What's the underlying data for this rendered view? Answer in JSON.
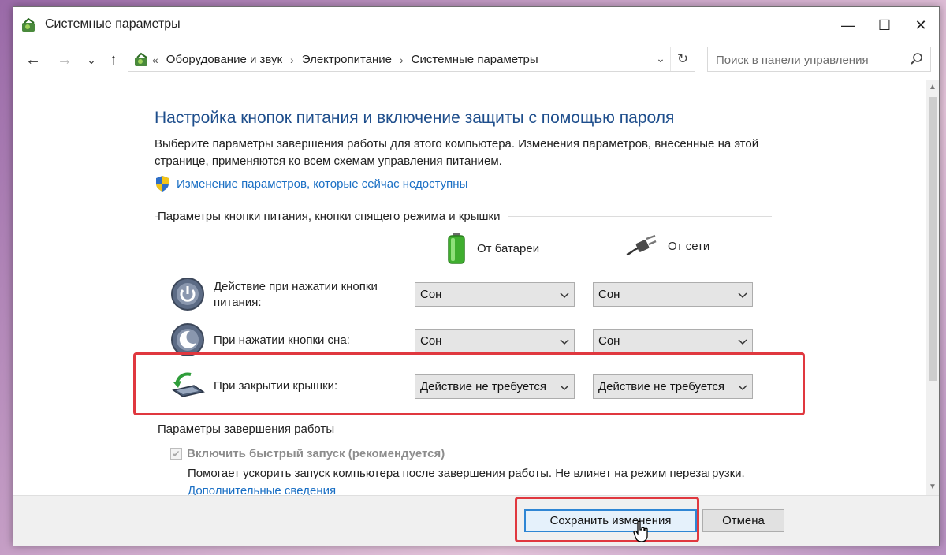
{
  "window": {
    "title": "Системные параметры",
    "controls": {
      "minimize": "—",
      "maximize": "☐",
      "close": "✕"
    }
  },
  "nav": {
    "back": "←",
    "forward": "→",
    "recent": "⌄",
    "up": "↑"
  },
  "address": {
    "overflow": "«",
    "breadcrumbs": [
      "Оборудование и звук",
      "Электропитание",
      "Системные параметры"
    ],
    "separator": "›"
  },
  "search": {
    "placeholder": "Поиск в панели управления"
  },
  "main": {
    "heading": "Настройка кнопок питания и включение защиты с помощью пароля",
    "description": "Выберите параметры завершения работы для этого компьютера. Изменения параметров, внесенные на этой странице, применяются ко всем схемам управления питанием.",
    "uac_link": "Изменение параметров, которые сейчас недоступны",
    "group1_label": "Параметры кнопки питания, кнопки спящего режима и крышки",
    "col_battery": "От батареи",
    "col_ac": "От сети",
    "rows": [
      {
        "label": "Действие при нажатии кнопки питания:",
        "battery": "Сон",
        "ac": "Сон"
      },
      {
        "label": "При нажатии кнопки сна:",
        "battery": "Сон",
        "ac": "Сон"
      },
      {
        "label": "При закрытии крышки:",
        "battery": "Действие не требуется",
        "ac": "Действие не требуется"
      }
    ],
    "group2_label": "Параметры завершения работы",
    "fast_startup": {
      "checked": true,
      "enabled": false,
      "label": "Включить быстрый запуск (рекомендуется)",
      "help": "Помогает ускорить запуск компьютера после завершения работы. Не влияет на режим перезагрузки.",
      "help_link": "Дополнительные сведения"
    }
  },
  "footer": {
    "save_label": "Сохранить изменения",
    "cancel_label": "Отмена"
  },
  "colors": {
    "heading": "#1e4e8c",
    "link": "#1a6fc4",
    "highlight": "#e0383f",
    "primary_border": "#2f86d4"
  }
}
